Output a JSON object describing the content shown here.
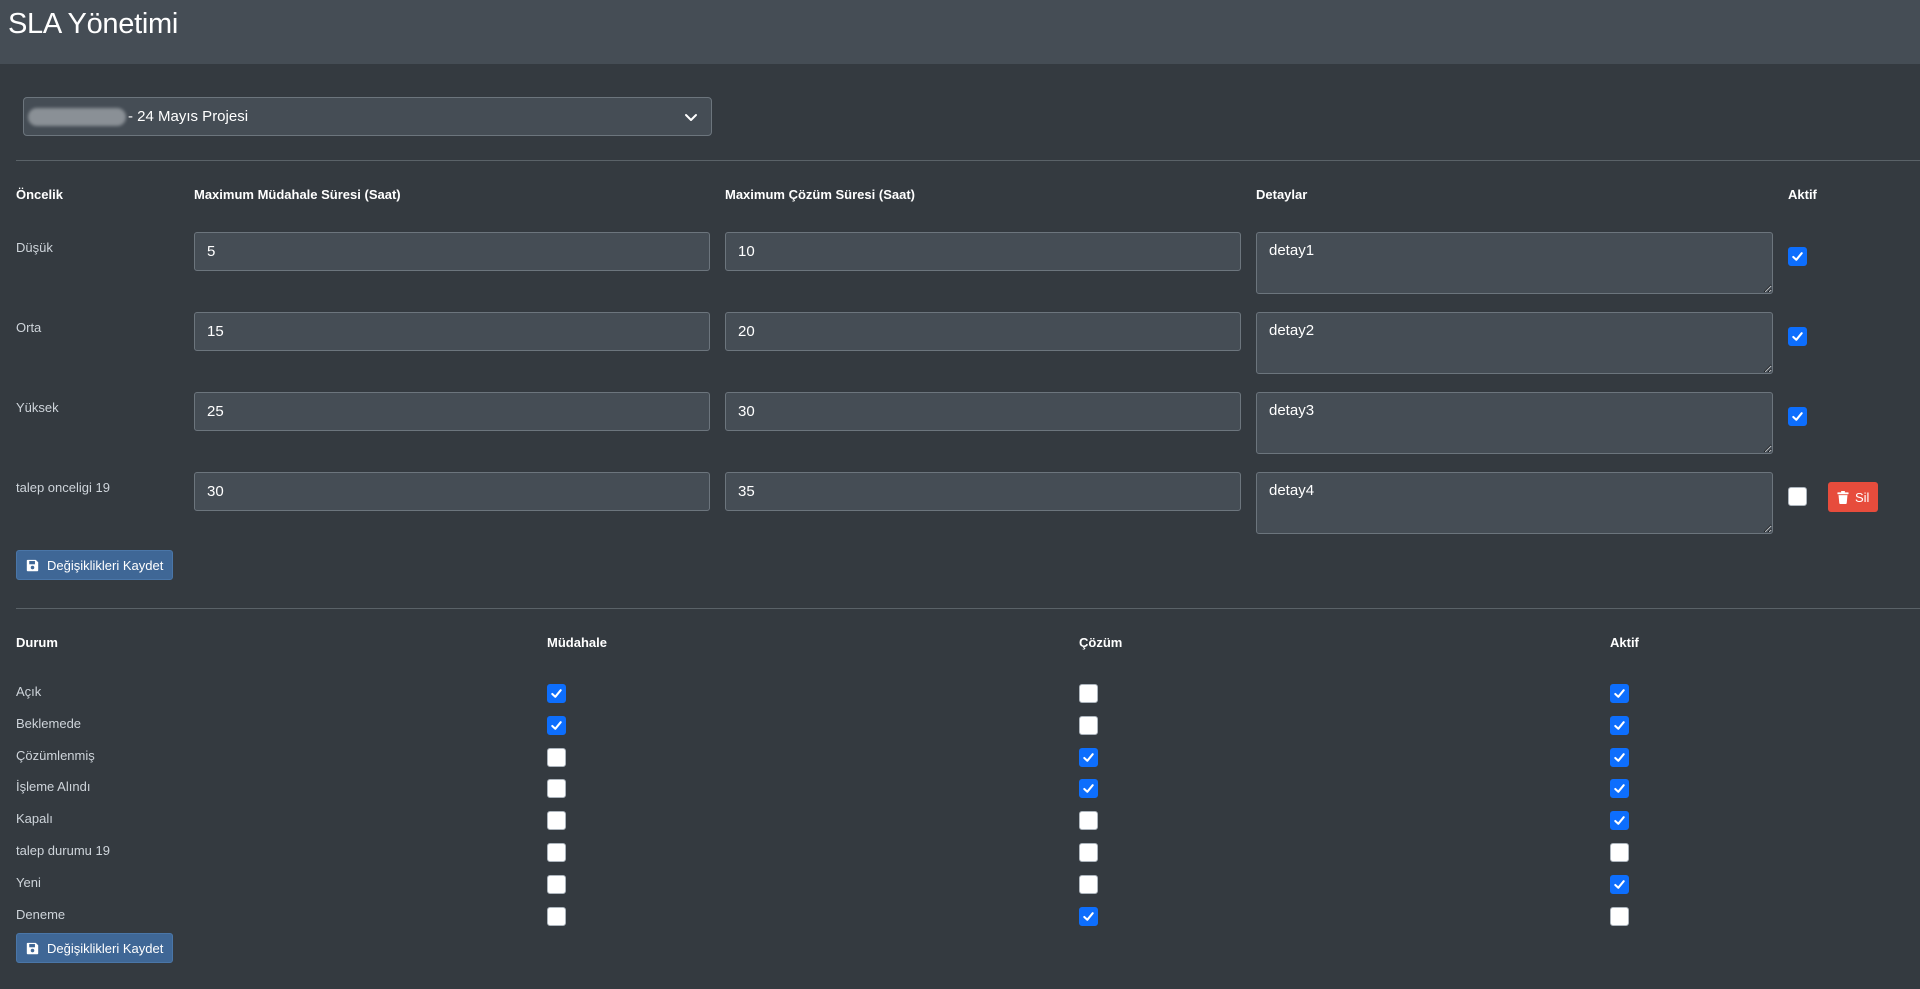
{
  "header": {
    "title": "SLA Yönetimi"
  },
  "project": {
    "selected": "- 24 Mayıs Projesi"
  },
  "priority_table": {
    "headers": {
      "priority": "Öncelik",
      "response": "Maximum Müdahale Süresi (Saat)",
      "resolution": "Maximum Çözüm Süresi (Saat)",
      "details": "Detaylar",
      "active": "Aktif"
    },
    "rows": [
      {
        "name": "Düşük",
        "response": "5",
        "resolution": "10",
        "details": "detay1",
        "active": true
      },
      {
        "name": "Orta",
        "response": "15",
        "resolution": "20",
        "details": "detay2",
        "active": true
      },
      {
        "name": "Yüksek",
        "response": "25",
        "resolution": "30",
        "details": "detay3",
        "active": true
      },
      {
        "name": "talep onceligi 19",
        "response": "30",
        "resolution": "35",
        "details": "detay4",
        "active": false,
        "delete_label": "Sil"
      }
    ],
    "save_label": "Değişiklikleri Kaydet"
  },
  "status_table": {
    "headers": {
      "status": "Durum",
      "response": "Müdahale",
      "resolution": "Çözüm",
      "active": "Aktif"
    },
    "rows": [
      {
        "name": "Açık",
        "response": true,
        "resolution": false,
        "active": true
      },
      {
        "name": "Beklemede",
        "response": true,
        "resolution": false,
        "active": true
      },
      {
        "name": "Çözümlenmiş",
        "response": false,
        "resolution": true,
        "active": true
      },
      {
        "name": "İşleme Alındı",
        "response": false,
        "resolution": true,
        "active": true
      },
      {
        "name": "Kapalı",
        "response": false,
        "resolution": false,
        "active": true
      },
      {
        "name": "talep durumu 19",
        "response": false,
        "resolution": false,
        "active": false
      },
      {
        "name": "Yeni",
        "response": false,
        "resolution": false,
        "active": true
      },
      {
        "name": "Deneme",
        "response": false,
        "resolution": true,
        "active": false
      }
    ],
    "save_label": "Değişiklikleri Kaydet"
  }
}
